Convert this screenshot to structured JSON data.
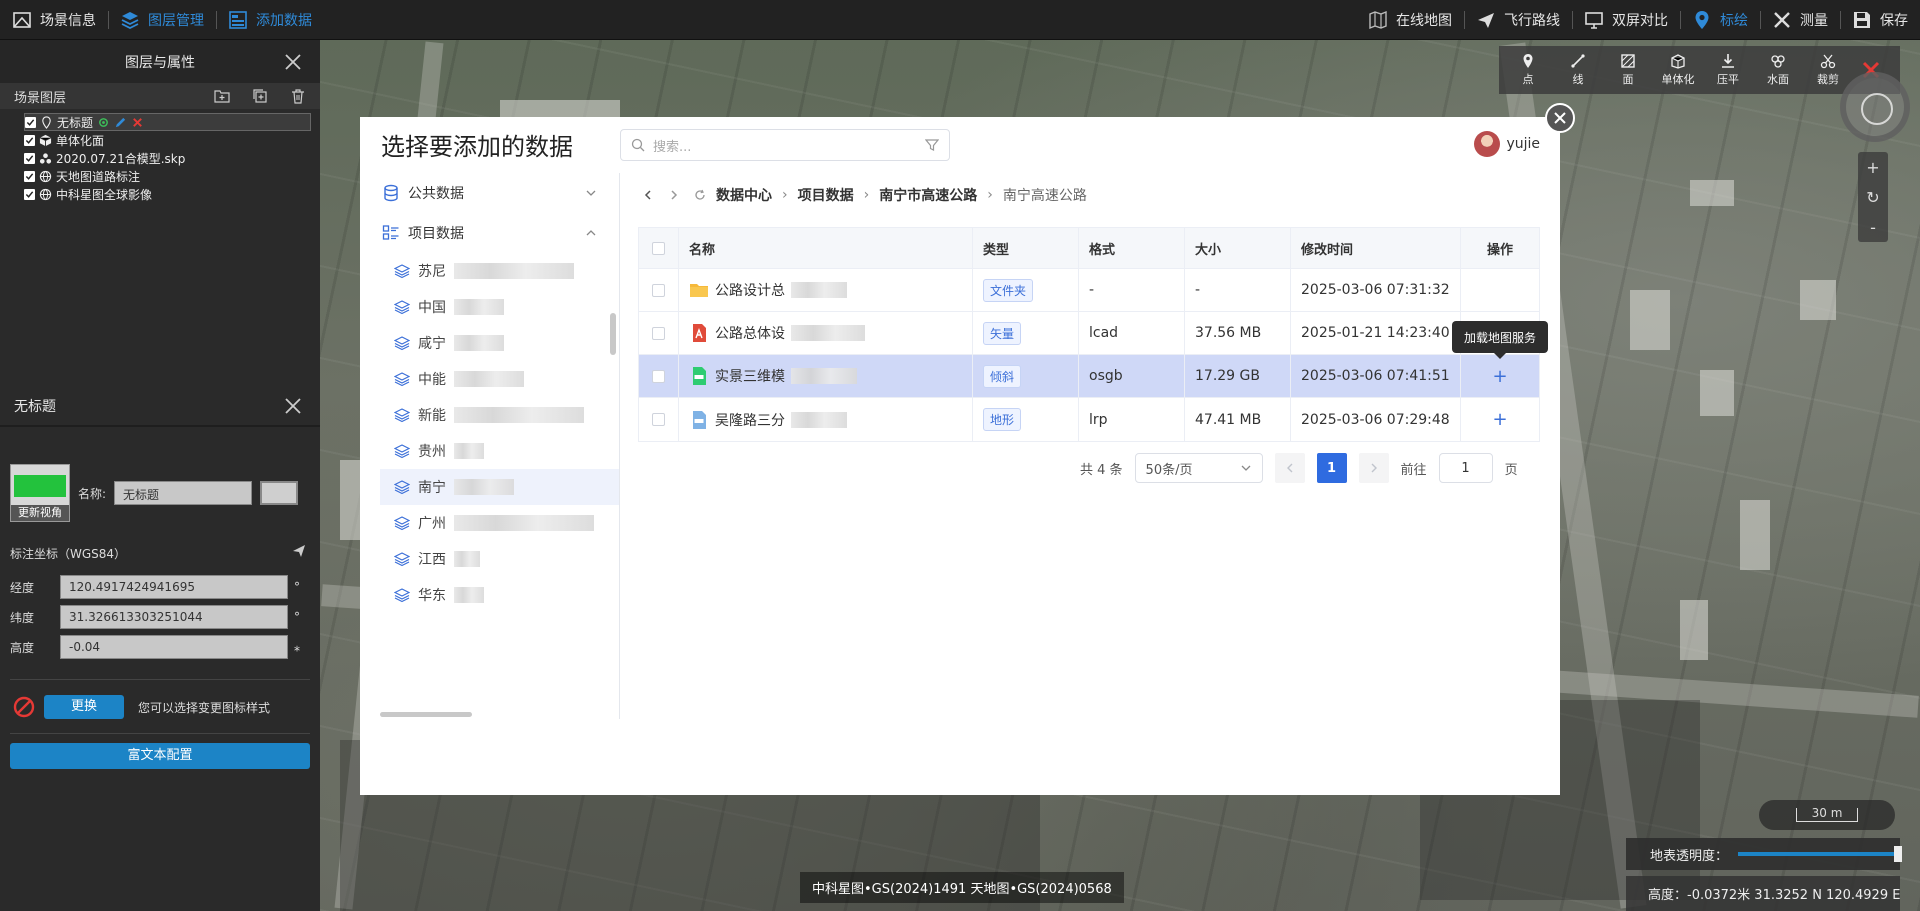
{
  "topbar": {
    "left": [
      {
        "label": "场景信息",
        "icon": "scene-info-icon",
        "active": false
      },
      {
        "label": "图层管理",
        "icon": "layers-icon",
        "active": true
      },
      {
        "label": "添加数据",
        "icon": "add-data-icon",
        "active": true
      }
    ],
    "right": [
      {
        "label": "在线地图",
        "icon": "online-map-icon",
        "active": false
      },
      {
        "label": "飞行路线",
        "icon": "flight-route-icon",
        "active": false
      },
      {
        "label": "双屏对比",
        "icon": "dual-screen-icon",
        "active": false
      },
      {
        "label": "标绘",
        "icon": "plot-marker-icon",
        "active": true
      },
      {
        "label": "测量",
        "icon": "measure-icon",
        "active": false
      },
      {
        "label": "保存",
        "icon": "save-icon",
        "active": false
      }
    ]
  },
  "left_panel": {
    "title": "图层与属性",
    "scene_layers_label": "场景图层",
    "layers": [
      {
        "label": "无标题",
        "icon": "pin-icon",
        "selected": true
      },
      {
        "label": "单体化面",
        "icon": "cube-icon",
        "selected": false
      },
      {
        "label": "2020.07.21合模型.skp",
        "icon": "model-icon",
        "selected": false
      },
      {
        "label": "天地图道路标注",
        "icon": "globe-icon",
        "selected": false
      },
      {
        "label": "中科星图全球影像",
        "icon": "globe-icon",
        "selected": false
      }
    ]
  },
  "properties": {
    "title": "无标题",
    "thumbnail_label": "更新视角",
    "name_label": "名称:",
    "name_value": "无标题",
    "coord_title": "标注坐标（WGS84）",
    "lon_label": "经度",
    "lon_value": "120.4917424941695",
    "lon_unit": "°",
    "lat_label": "纬度",
    "lat_value": "31.326613303251044",
    "lat_unit": "°",
    "alt_label": "高度",
    "alt_value": "-0.04",
    "alt_unit": "⁎",
    "change_button": "更换",
    "change_hint": "您可以选择变更图标样式",
    "rich_text_button": "富文本配置"
  },
  "map": {
    "tools": [
      {
        "label": "点",
        "icon": "point-icon"
      },
      {
        "label": "线",
        "icon": "line-icon"
      },
      {
        "label": "面",
        "icon": "polygon-icon"
      },
      {
        "label": "单体化",
        "icon": "monomer-icon"
      },
      {
        "label": "压平",
        "icon": "flatten-icon"
      },
      {
        "label": "水面",
        "icon": "water-icon"
      },
      {
        "label": "裁剪",
        "icon": "clip-icon"
      }
    ],
    "zoom_in": "+",
    "zoom_reset": "↻",
    "zoom_out": "-",
    "scale": "30 m",
    "opacity_label": "地表透明度：",
    "opacity_value": 1,
    "elevation": "高度：-0.0372米 31.3252 N 120.4929 E",
    "attribution": "中科星图•GS(2024)1491 天地图•GS(2024)0568"
  },
  "modal": {
    "title": "选择要添加的数据",
    "search_placeholder": "搜索...",
    "user": "yujie",
    "side": {
      "public_label": "公共数据",
      "project_label": "项目数据",
      "projects": [
        {
          "label": "苏尼",
          "active": false
        },
        {
          "label": "中国",
          "active": false
        },
        {
          "label": "咸宁",
          "active": false
        },
        {
          "label": "中能",
          "active": false
        },
        {
          "label": "新能",
          "active": false
        },
        {
          "label": "贵州",
          "active": false
        },
        {
          "label": "南宁",
          "active": true
        },
        {
          "label": "广州",
          "active": false
        },
        {
          "label": "江西",
          "active": false
        },
        {
          "label": "华东",
          "active": false
        }
      ]
    },
    "breadcrumb": [
      "数据中心",
      "项目数据",
      "南宁市高速公路",
      "南宁高速公路"
    ],
    "columns": [
      "名称",
      "类型",
      "格式",
      "大小",
      "修改时间",
      "操作"
    ],
    "rows": [
      {
        "name": "公路设计总",
        "icon": "folder-icon",
        "type": "文件夹",
        "format": "-",
        "size": "-",
        "modified": "2025-03-06 07:31:32",
        "action": "",
        "highlight": false
      },
      {
        "name": "公路总体设",
        "icon": "cad-file-icon",
        "type": "矢量",
        "format": "lcad",
        "size": "37.56 MB",
        "modified": "2025-01-21 14:23:40",
        "action": "",
        "highlight": false
      },
      {
        "name": "实景三维模",
        "icon": "osgb-file-icon",
        "type": "倾斜",
        "format": "osgb",
        "size": "17.29 GB",
        "modified": "2025-03-06 07:41:51",
        "action": "+",
        "highlight": true
      },
      {
        "name": "吴隆路三分",
        "icon": "lrp-file-icon",
        "type": "地形",
        "format": "lrp",
        "size": "47.41 MB",
        "modified": "2025-03-06 07:29:48",
        "action": "+",
        "highlight": false
      }
    ],
    "tooltip": "加载地图服务",
    "pager": {
      "total": "共 4 条",
      "page_size": "50条/页",
      "current": "1",
      "goto_label": "前往",
      "goto_value": "1",
      "page_suffix": "页"
    }
  }
}
